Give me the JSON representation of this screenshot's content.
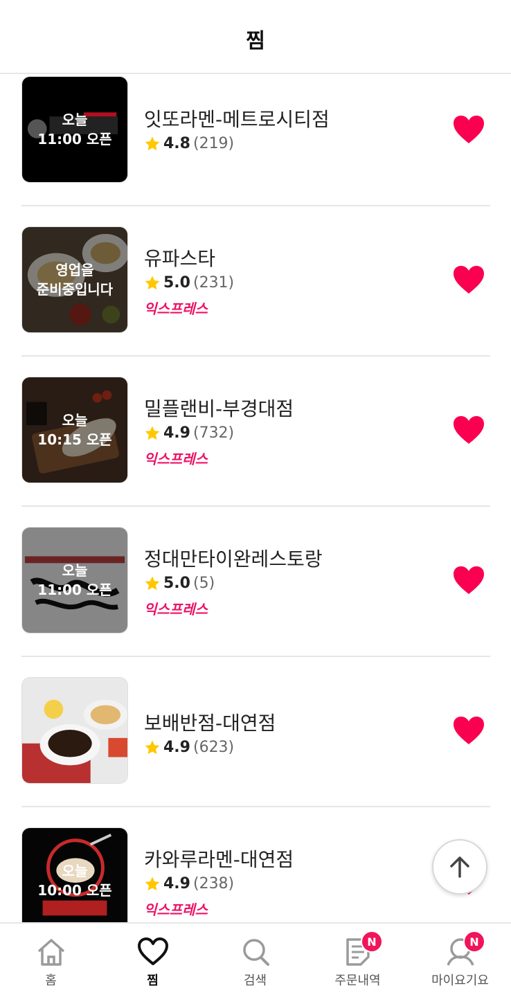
{
  "header": {
    "title": "찜"
  },
  "colors": {
    "accent": "#fa0050",
    "express": "#ee1165",
    "star": "#ffc800"
  },
  "items": [
    {
      "name": "잇또라멘-메트로시티점",
      "score": "4.8",
      "count": "(219)",
      "overlay": "오늘\n11:00 오픈",
      "express": ""
    },
    {
      "name": "유파스타",
      "score": "5.0",
      "count": "(231)",
      "overlay": "영업을\n준비중입니다",
      "express": "익스프레스"
    },
    {
      "name": "밀플랜비-부경대점",
      "score": "4.9",
      "count": "(732)",
      "overlay": "오늘\n10:15 오픈",
      "express": "익스프레스"
    },
    {
      "name": "정대만타이완레스토랑",
      "score": "5.0",
      "count": "(5)",
      "overlay": "오늘\n11:00 오픈",
      "express": "익스프레스"
    },
    {
      "name": "보배반점-대연점",
      "score": "4.9",
      "count": "(623)",
      "overlay": "",
      "express": ""
    },
    {
      "name": "카와루라멘-대연점",
      "score": "4.9",
      "count": "(238)",
      "overlay": "오늘\n10:00 오픈",
      "express": "익스프레스"
    }
  ],
  "tabs": [
    {
      "label": "홈",
      "icon": "home-icon",
      "badge": ""
    },
    {
      "label": "찜",
      "icon": "heart-icon",
      "badge": ""
    },
    {
      "label": "검색",
      "icon": "search-icon",
      "badge": ""
    },
    {
      "label": "주문내역",
      "icon": "order-history-icon",
      "badge": "N"
    },
    {
      "label": "마이요기요",
      "icon": "profile-icon",
      "badge": "N"
    }
  ]
}
